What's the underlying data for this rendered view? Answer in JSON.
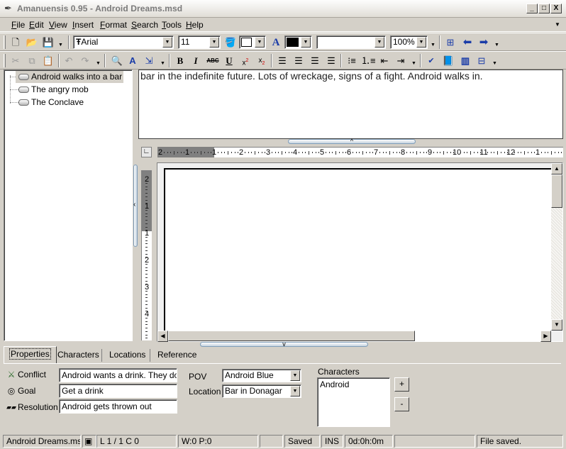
{
  "window": {
    "title": "Amanuensis 0.95 - Android Dreams.msd",
    "controls": {
      "minimize": "_",
      "maximize": "□",
      "close": "X"
    }
  },
  "menu": [
    {
      "label": "File",
      "key": "F",
      "rest": "ile"
    },
    {
      "label": "Edit",
      "key": "E",
      "rest": "dit"
    },
    {
      "label": "View",
      "key": "V",
      "rest": "iew"
    },
    {
      "label": "Insert",
      "key": "I",
      "rest": "nsert"
    },
    {
      "label": "Format",
      "key": "F",
      "rest": "ormat"
    },
    {
      "label": "Search",
      "key": "S",
      "rest": "earch"
    },
    {
      "label": "Tools",
      "key": "T",
      "rest": "ools"
    },
    {
      "label": "Help",
      "key": "H",
      "rest": "elp"
    }
  ],
  "toolbar1": {
    "font": "Arial",
    "font_prefix": "Ŧ",
    "size": "11",
    "zoom": "100%",
    "style": "",
    "fg_color": "#000000",
    "bg_color": "#ffffff"
  },
  "tree": {
    "items": [
      {
        "label": "Android walks into a bar",
        "selected": true
      },
      {
        "label": "The angry mob",
        "selected": false
      },
      {
        "label": "The Conclave",
        "selected": false
      }
    ]
  },
  "summary": {
    "text": "bar in the indefinite future. Lots of wreckage, signs of a fight. Android walks in."
  },
  "ruler": {
    "h_labels": [
      "2",
      "1",
      "1",
      "2",
      "3",
      "4",
      "5",
      "6",
      "7",
      "8",
      "9",
      "10",
      "11",
      "12",
      "1"
    ],
    "v_labels": [
      "2",
      "1",
      "1",
      "2",
      "3",
      "4"
    ]
  },
  "tabs": [
    {
      "label": "Properties",
      "active": true
    },
    {
      "label": "Characters",
      "active": false
    },
    {
      "label": "Locations",
      "active": false
    },
    {
      "label": "Reference",
      "active": false
    }
  ],
  "properties": {
    "conflict_label": "Conflict",
    "conflict_value": "Android wants a drink. They don't",
    "goal_label": "Goal",
    "goal_value": "Get a drink",
    "resolution_label": "Resolution",
    "resolution_value": "Android gets thrown out",
    "pov_label": "POV",
    "pov_value": "Android Blue",
    "location_label": "Location",
    "location_value": "Bar in Donagar",
    "characters_label": "Characters",
    "characters": [
      "Android"
    ],
    "add_label": "+",
    "remove_label": "-"
  },
  "status": {
    "file": "Android Dreams.msd",
    "position": "L 1 / 1  C 0",
    "wp": "W:0  P:0",
    "blank": "",
    "saved": "Saved",
    "mode": "INS",
    "timer": "0d:0h:0m",
    "blank2": "",
    "message": "File saved."
  }
}
